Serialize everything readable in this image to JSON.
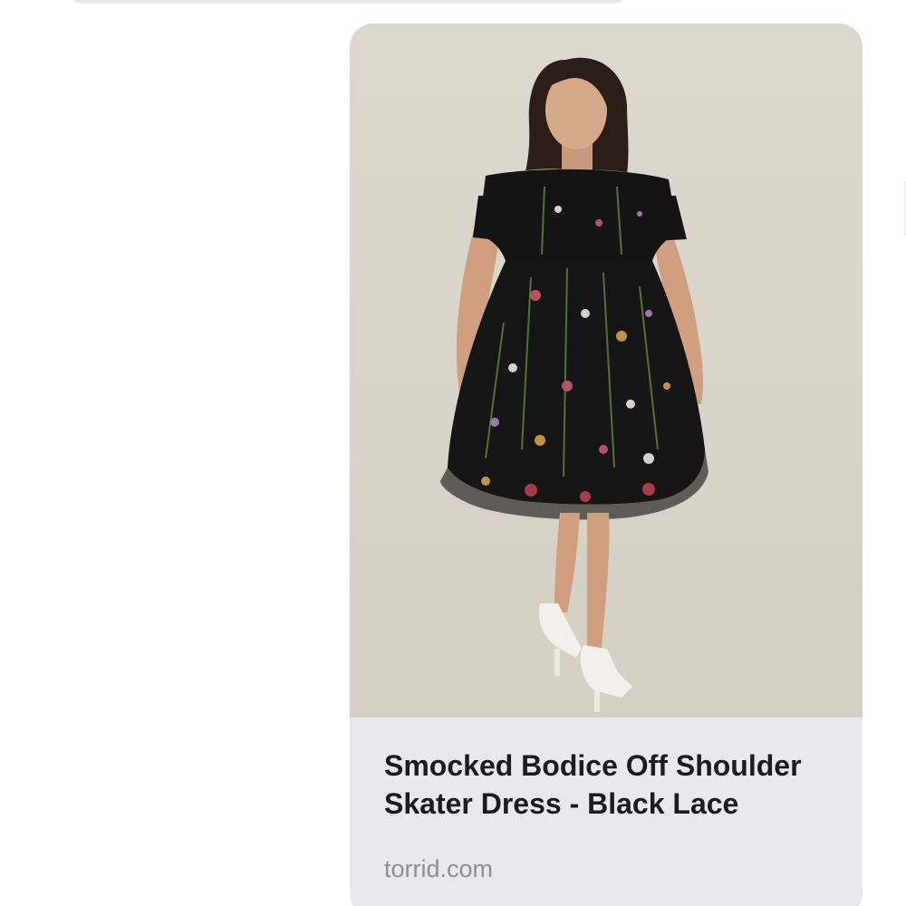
{
  "link_preview": {
    "title": "Smocked Bodice Off Shoulder Skater Dress - Black Lace",
    "domain": "torrid.com"
  },
  "colors": {
    "bubble_background": "#e9e9eb",
    "title_text": "#1c1c1e",
    "domain_text": "#8e8e93",
    "dress": "#141414",
    "backdrop": "#dad6cb"
  },
  "icons": {
    "preview_image": "product-photo-woman-in-floral-black-lace-dress"
  }
}
